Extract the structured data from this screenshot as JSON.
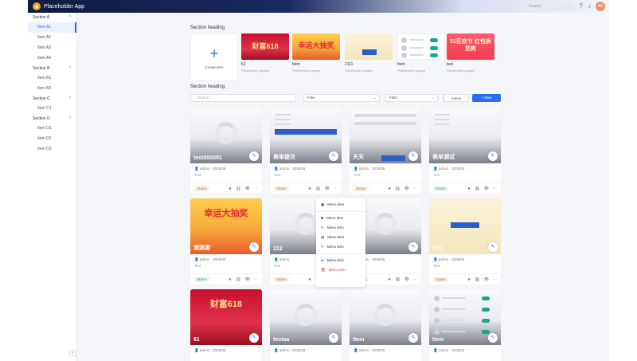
{
  "app": {
    "title": "Placeholder App",
    "logo_glyph": "◆",
    "avatar_text": "AB"
  },
  "topbar": {
    "search_placeholder": "Search"
  },
  "sidebar": {
    "groups": [
      {
        "label": "Section A",
        "items": [
          "Item A1",
          "Item A2",
          "Item A3",
          "Item A4"
        ]
      },
      {
        "label": "Section B",
        "items": [
          "Item B1",
          "Item B2"
        ]
      },
      {
        "label": "Section C",
        "items": [
          "Item C1"
        ]
      },
      {
        "label": "Section D",
        "items": [
          "Item D1",
          "Item D2",
          "Item D3"
        ]
      }
    ],
    "collapse_glyph": "«"
  },
  "templates": {
    "section_title": "Section heading",
    "create_label": "Create item",
    "create_glyph": "+",
    "items": [
      {
        "name": "61",
        "sub": "Placeholder caption",
        "poster_text": "财富618"
      },
      {
        "name": "Item",
        "sub": "Placeholder caption",
        "poster_text": "幸运大抽奖"
      },
      {
        "name": "2111",
        "sub": "Placeholder caption",
        "poster_text": ""
      },
      {
        "name": "Item",
        "sub": "Placeholder caption",
        "poster_text": ""
      },
      {
        "name": "text",
        "sub": "Placeholder caption",
        "poster_text": "51狂欢节 红包拆到爽"
      }
    ]
  },
  "activities": {
    "section_title": "Section heading",
    "search_placeholder": "Search",
    "filter1": "Filter",
    "filter2": "Filter",
    "filter3": "Filter",
    "btn_secondary": "Action",
    "btn_primary": "+ New",
    "cards": [
      {
        "title": "test000001",
        "meta": "admin · 2025/06",
        "meta2": "Text",
        "status": "Status",
        "status_kind": "un",
        "poster": "placeholder"
      },
      {
        "title": "表单提交",
        "meta": "admin · 2025/06",
        "meta2": "Text",
        "status": "Status",
        "status_kind": "un",
        "poster": "form"
      },
      {
        "title": "天天",
        "meta": "admin · 2025/06",
        "meta2": "Text",
        "status": "Status",
        "status_kind": "un",
        "poster": "form2"
      },
      {
        "title": "表单测试",
        "meta": "admin · 2025/06",
        "meta2": "Text",
        "status": "Status",
        "status_kind": "on",
        "poster": "form3"
      },
      {
        "title": "酒酒酒",
        "meta": "admin · 2025/06",
        "meta2": "Text",
        "status": "Status",
        "status_kind": "on",
        "poster": "lottery",
        "poster_text": "幸运大抽奖"
      },
      {
        "title": "212",
        "meta": "admin",
        "meta2": "Text",
        "status": "Status",
        "status_kind": "un",
        "poster": "placeholder"
      },
      {
        "title": "2323",
        "meta": "admin · 2025/06",
        "meta2": "Text",
        "status": "Status",
        "status_kind": "un",
        "poster": "placeholder"
      },
      {
        "title": "2111",
        "meta": "admin · 2025/06",
        "meta2": "Text",
        "status": "Status",
        "status_kind": "un",
        "poster": "cream"
      },
      {
        "title": "61",
        "meta": "admin · 2025/06",
        "meta2": "",
        "status": "",
        "status_kind": "un",
        "poster": "red",
        "poster_text": "财富618"
      },
      {
        "title": "testaa",
        "meta": "admin · 2025/06",
        "meta2": "",
        "status": "",
        "status_kind": "un",
        "poster": "placeholder"
      },
      {
        "title": "Item",
        "meta": "admin · 2025/06",
        "meta2": "",
        "status": "",
        "status_kind": "un",
        "poster": "placeholder"
      },
      {
        "title": "Item",
        "meta": "admin · 2025/06",
        "meta2": "",
        "status": "",
        "status_kind": "un",
        "poster": "list"
      }
    ]
  },
  "dropdown": {
    "items": [
      {
        "icon": "▣",
        "label": "Menu item"
      },
      {
        "icon": "⧉",
        "label": "Menu item"
      },
      {
        "icon": "✎",
        "label": "Menu item"
      },
      {
        "icon": "▤",
        "label": "Menu item"
      },
      {
        "icon": "✎",
        "label": "Menu item"
      },
      {
        "icon": "➤",
        "label": "Menu item"
      },
      {
        "icon": "🗑",
        "label": "Menu item",
        "danger": true
      }
    ]
  },
  "icons": {
    "help": "?",
    "bell": "♪",
    "edit": "✎",
    "star": "★",
    "link": "⛓",
    "eye": "👁",
    "more": "⋯",
    "user": "👤"
  }
}
